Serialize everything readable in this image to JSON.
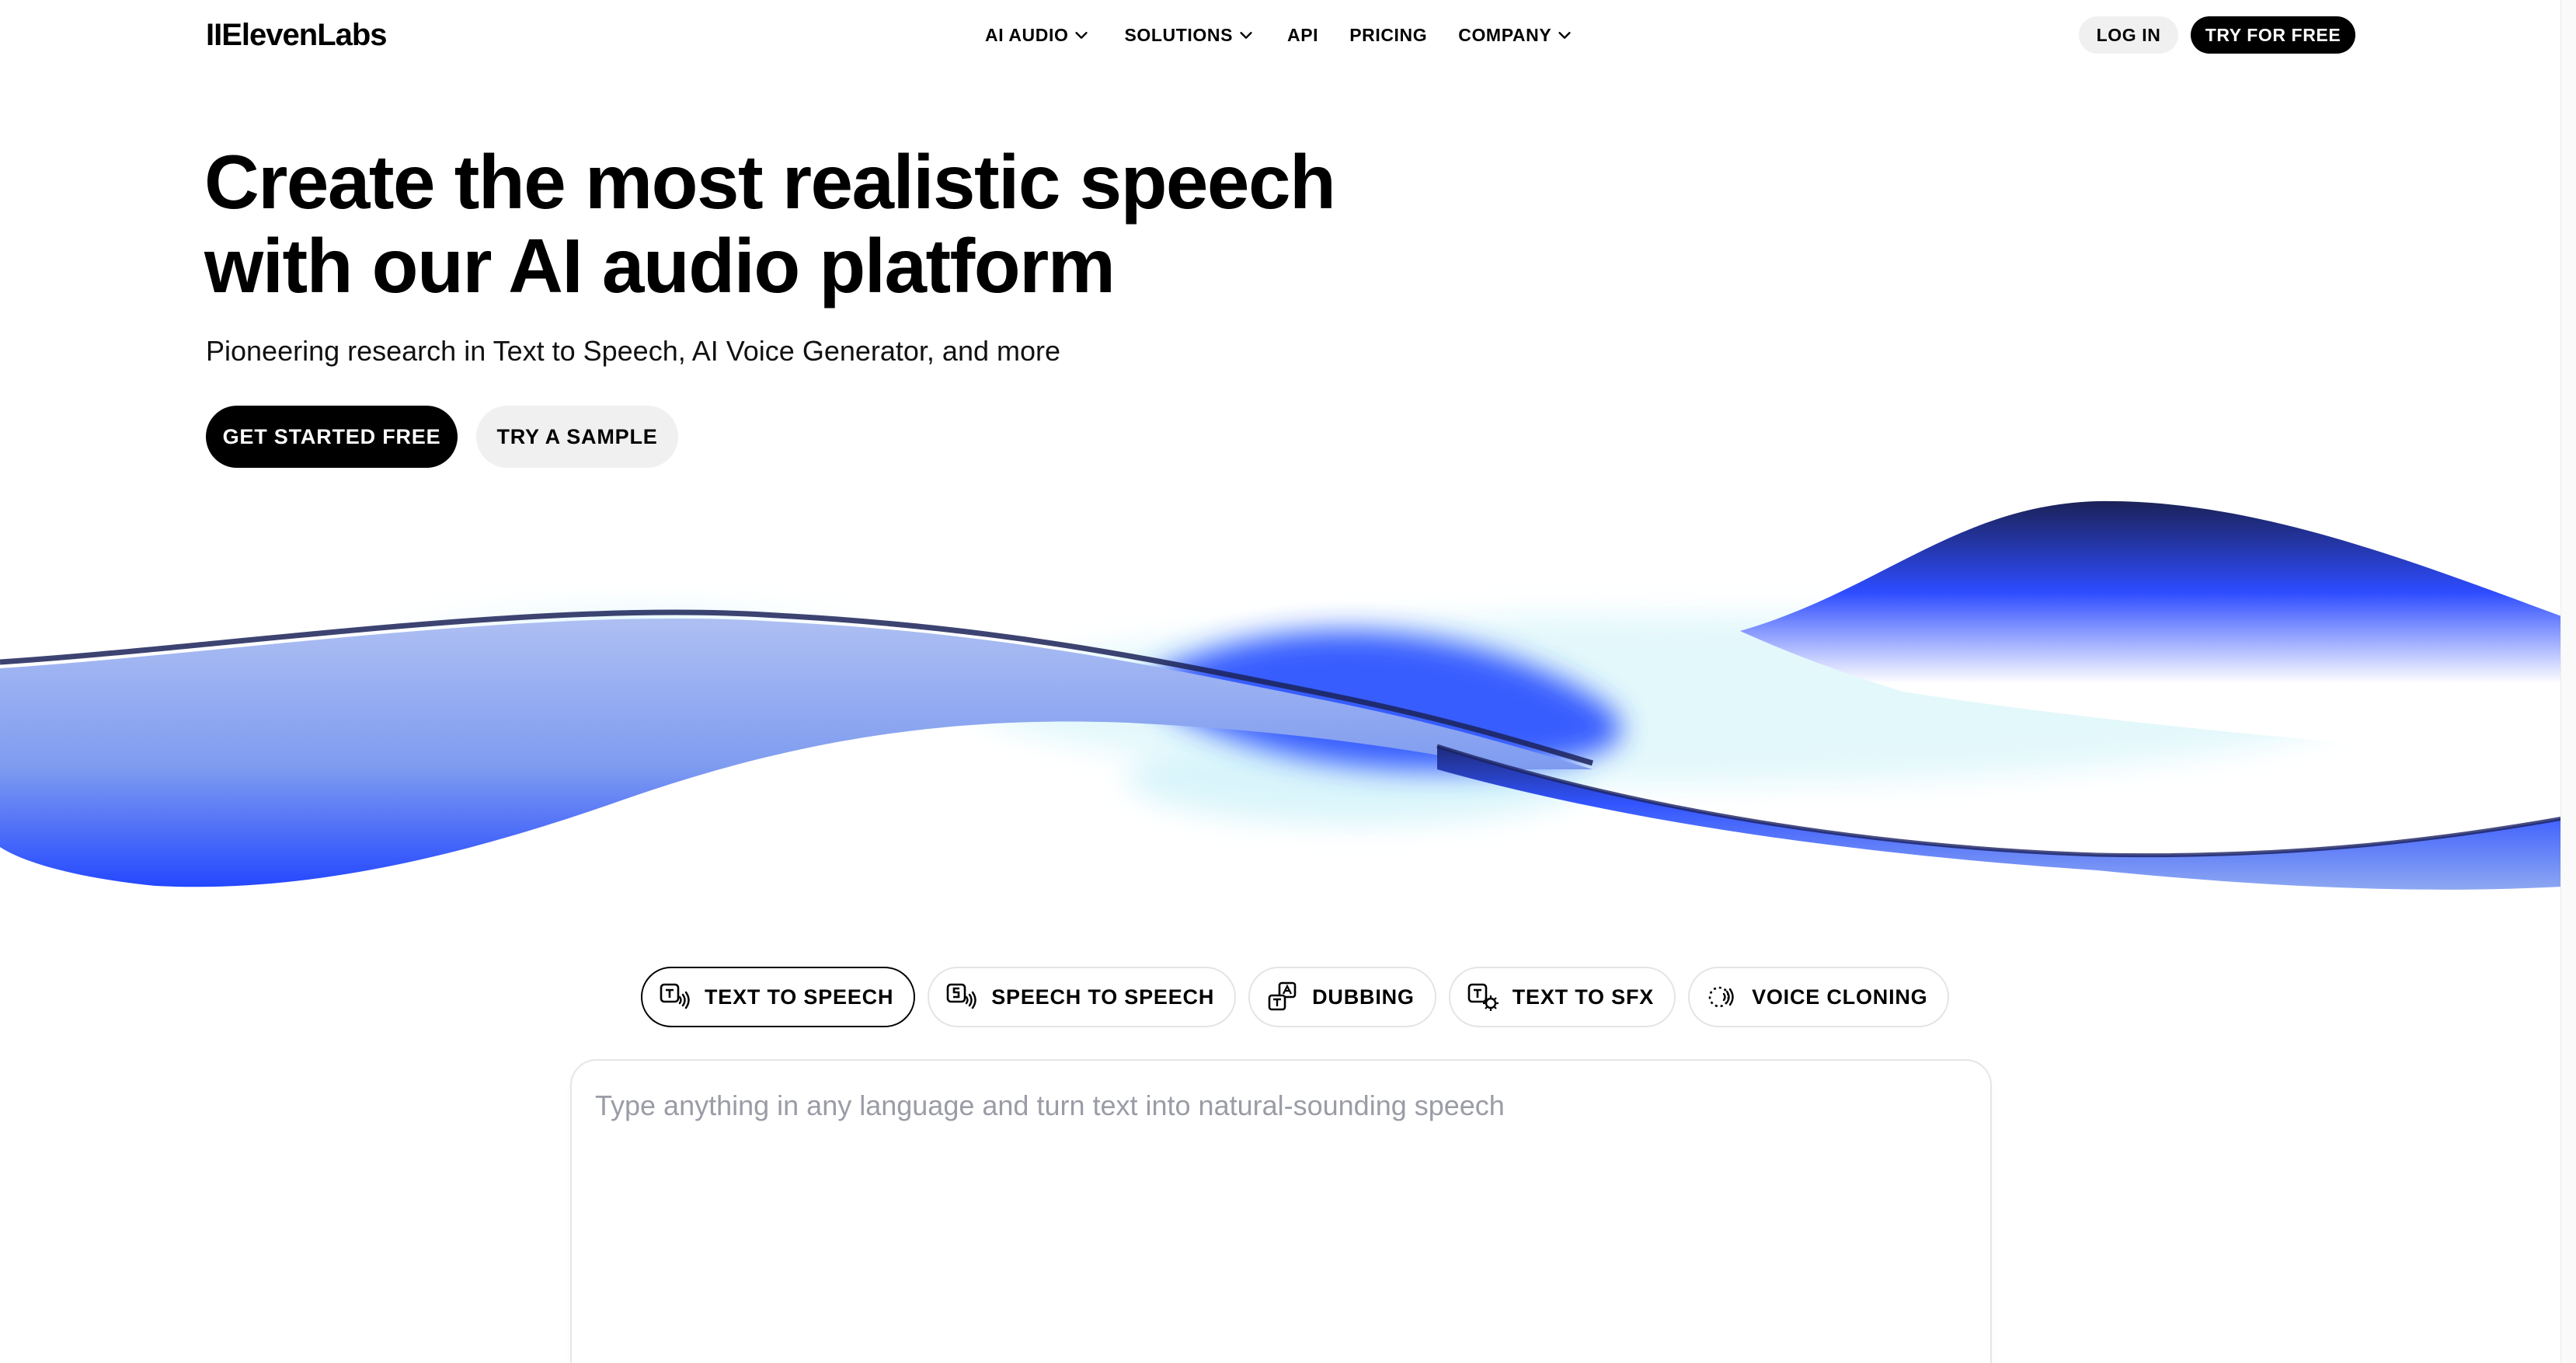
{
  "nav": {
    "logo": "IIElevenLabs",
    "items": [
      {
        "label": "AI AUDIO",
        "has_dropdown": true
      },
      {
        "label": "SOLUTIONS",
        "has_dropdown": true
      },
      {
        "label": "API",
        "has_dropdown": false
      },
      {
        "label": "PRICING",
        "has_dropdown": false
      },
      {
        "label": "COMPANY",
        "has_dropdown": true
      }
    ],
    "login_label": "LOG IN",
    "try_free_label": "TRY FOR FREE"
  },
  "hero": {
    "title_line1": "Create the most realistic speech",
    "title_line2": "with our AI audio platform",
    "subtitle": "Pioneering research in Text to Speech, AI Voice Generator, and more",
    "primary_cta": "GET STARTED FREE",
    "secondary_cta": "TRY A SAMPLE"
  },
  "tabs": [
    {
      "label": "TEXT TO SPEECH",
      "icon": "text-to-speech-icon",
      "active": true
    },
    {
      "label": "SPEECH TO SPEECH",
      "icon": "speech-to-speech-icon",
      "active": false
    },
    {
      "label": "DUBBING",
      "icon": "dubbing-icon",
      "active": false
    },
    {
      "label": "TEXT TO SFX",
      "icon": "text-to-sfx-icon",
      "active": false
    },
    {
      "label": "VOICE CLONING",
      "icon": "voice-cloning-icon",
      "active": false
    }
  ],
  "tts": {
    "placeholder": "Type anything in any language and turn text into natural-sounding speech"
  },
  "colors": {
    "brand_black": "#000000",
    "wave_blue": "#2f55ff",
    "wave_light_blue": "#9fb4f0",
    "wave_cyan": "#d8f6fb",
    "wave_dark": "#1b2258",
    "placeholder_gray": "#9a9ca6"
  }
}
